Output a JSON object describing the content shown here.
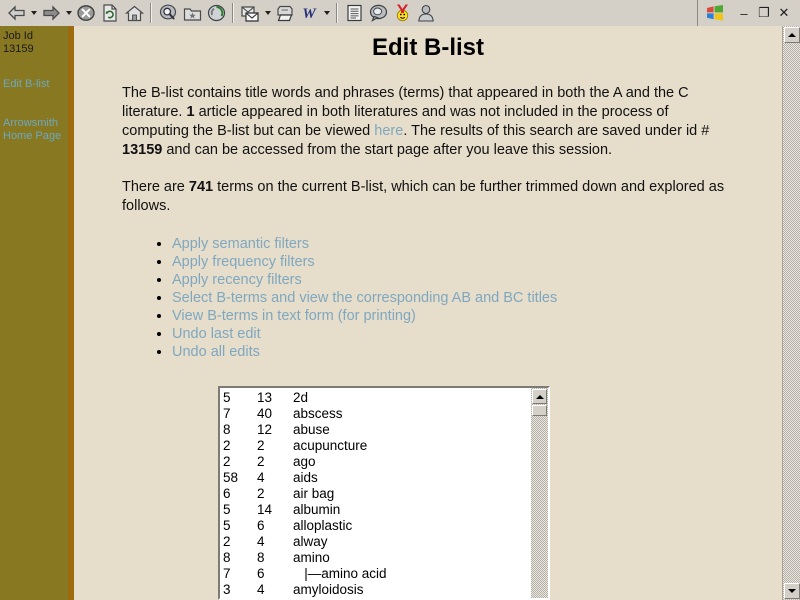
{
  "toolbar": {
    "buttons": [
      {
        "name": "back-button",
        "icon": "back-arrow-icon",
        "caret": true
      },
      {
        "name": "forward-button",
        "icon": "forward-arrow-icon",
        "caret": true
      },
      {
        "name": "stop-button",
        "icon": "stop-icon",
        "caret": false
      },
      {
        "name": "refresh-button",
        "icon": "refresh-icon",
        "caret": false
      },
      {
        "name": "home-button",
        "icon": "home-icon",
        "caret": false
      },
      {
        "name": "search-button",
        "icon": "search-icon",
        "caret": false
      },
      {
        "name": "favorites-button",
        "icon": "favorites-folder-icon",
        "caret": false
      },
      {
        "name": "history-button",
        "icon": "history-icon",
        "caret": false
      },
      {
        "name": "mail-button",
        "icon": "mail-icon",
        "caret": true
      },
      {
        "name": "print-button",
        "icon": "printer-icon",
        "caret": false
      },
      {
        "name": "edit-word-button",
        "icon": "word-w-icon",
        "caret": true
      },
      {
        "name": "discuss-button",
        "icon": "document-lines-icon",
        "caret": false
      },
      {
        "name": "messenger-button",
        "icon": "speech-bubble-icon",
        "caret": false
      },
      {
        "name": "yahoo-button",
        "icon": "yahoo-face-icon",
        "caret": false
      },
      {
        "name": "profile-button",
        "icon": "person-icon",
        "caret": false
      }
    ],
    "window_controls": {
      "logo": "windows-logo-icon",
      "minimize": "–",
      "restore": "❐",
      "close": "✕"
    }
  },
  "sidebar": {
    "job_label": "Job Id",
    "job_id": "13159",
    "links": [
      {
        "label": "Edit B-list"
      },
      {
        "label": "Arrowsmith Home Page"
      }
    ]
  },
  "main": {
    "title": "Edit B-list",
    "paragraph1": {
      "part1": "The B-list contains title words and phrases (terms) that appeared in both the A and the C literature. ",
      "bold1": "1",
      "part2": " article appeared in both literatures and was not included in the process of computing the B-list but can be viewed ",
      "link": "here",
      "part3": ". The results of this search are saved under id # ",
      "bold2": "13159",
      "part4": " and can be accessed from the start page after you leave this session."
    },
    "paragraph2": {
      "part1": "There are ",
      "bold1": "741",
      "part2": " terms on the current B-list, which can be further trimmed down and explored as follows."
    },
    "action_links": [
      "Apply semantic filters",
      "Apply frequency filters",
      "Apply recency filters",
      "Select B-terms and view the corresponding AB and BC titles",
      "View B-terms in text form (for printing)",
      "Undo last edit",
      "Undo all edits"
    ],
    "term_list": [
      {
        "a": "5",
        "b": "13",
        "term": "2d"
      },
      {
        "a": "7",
        "b": "40",
        "term": "abscess"
      },
      {
        "a": "8",
        "b": "12",
        "term": "abuse"
      },
      {
        "a": "2",
        "b": "2",
        "term": "acupuncture"
      },
      {
        "a": "2",
        "b": "2",
        "term": "ago"
      },
      {
        "a": "58",
        "b": "4",
        "term": "aids"
      },
      {
        "a": "6",
        "b": "2",
        "term": "air bag"
      },
      {
        "a": "5",
        "b": "14",
        "term": "albumin"
      },
      {
        "a": "5",
        "b": "6",
        "term": "alloplastic"
      },
      {
        "a": "2",
        "b": "4",
        "term": "alway"
      },
      {
        "a": "8",
        "b": "8",
        "term": "amino"
      },
      {
        "a": "7",
        "b": "6",
        "term": "   |—amino acid"
      },
      {
        "a": "3",
        "b": "4",
        "term": "amyloidosis"
      }
    ]
  }
}
